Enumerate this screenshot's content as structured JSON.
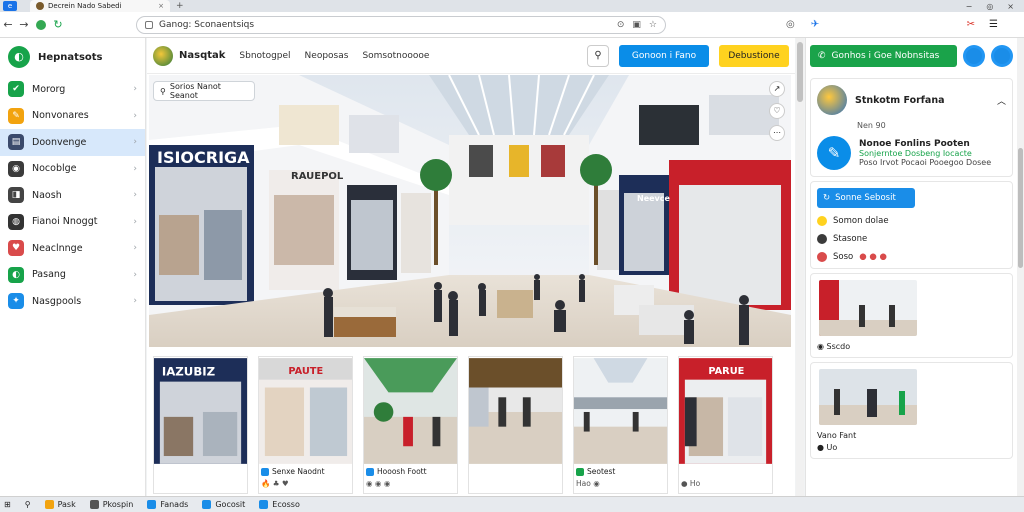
{
  "browser": {
    "tab_title": "Decrein Nado Sabedi",
    "new_tab_symbol": "+",
    "omnibox_text": "Ganog: Sconaentsiqs",
    "window_controls": [
      "−",
      "◎",
      "×"
    ]
  },
  "sidebar": {
    "brand": "Hepnatsots",
    "items": [
      {
        "label": "Mororg",
        "color": "#17a34a",
        "glyph": "✔"
      },
      {
        "label": "Nonvonares",
        "color": "#f2a30f",
        "glyph": "✎"
      },
      {
        "label": "Doonvenge",
        "color": "#3b4a6b",
        "glyph": "▤",
        "active": true
      },
      {
        "label": "Nocoblge",
        "color": "#3b3b3b",
        "glyph": "◉"
      },
      {
        "label": "Naosh",
        "color": "#444",
        "glyph": "◨"
      },
      {
        "label": "Fianoi Nnoggt",
        "color": "#333",
        "glyph": "◍"
      },
      {
        "label": "Neaclnnge",
        "color": "#d94b4b",
        "glyph": "♥"
      },
      {
        "label": "Pasang",
        "color": "#17a34a",
        "glyph": "◐"
      },
      {
        "label": "Nasgpools",
        "color": "#1a8de8",
        "glyph": "✦"
      }
    ]
  },
  "main": {
    "user": "Nasqtak",
    "links": [
      "Sbnotogpel",
      "Neoposas",
      "Somsotnooooe"
    ],
    "btn_primary": "Gonoon i Fano",
    "btn_secondary": "Debustione",
    "hero_search": "Sorios Nanot Seanot",
    "hero_store_sign": "ISIOCRIGA",
    "hero_store_sign2": "RAUEPOL",
    "hero_mid_sign": "Neevce",
    "thumbnails": [
      {
        "sign": "IAZUBIZ",
        "caption": "",
        "sub": ""
      },
      {
        "sign": "PAUTE",
        "caption": "Senxe Naodnt",
        "sub": "🔥 ♣ ♥"
      },
      {
        "sign": "",
        "caption": "Hooosh Foott",
        "sub": "◉ ◉ ◉"
      },
      {
        "sign": "",
        "caption": "",
        "sub": ""
      },
      {
        "sign": "",
        "caption": "Seotest",
        "sub": "Hao ◉"
      },
      {
        "sign": "PARUE",
        "caption": "",
        "sub": "●  Ho"
      }
    ]
  },
  "rpanel": {
    "btn_green": "Gonhos i Goe Nobnsitas",
    "profile_name": "Stnkotm Forfana",
    "profile_sub": "Nen 90",
    "app_title": "Nonoe Fonlins Pooten",
    "app_sub": "Sonjerntoe Dosbeng Iocacte",
    "app_detail": "Poso Irvot Pocaoi Pooegoo Dosee",
    "btn_blue": "Sonne Sebosit",
    "rows": [
      "Somon dolae",
      "Stasone",
      "Soso"
    ],
    "img1_caption": "◉ Sscdo",
    "img2_caption": "Vano Fant",
    "img2_sub": "● Uo"
  },
  "taskbar": [
    "Pask",
    "Pkospin",
    "Fanads",
    "Gocosit",
    "Ecosso"
  ]
}
